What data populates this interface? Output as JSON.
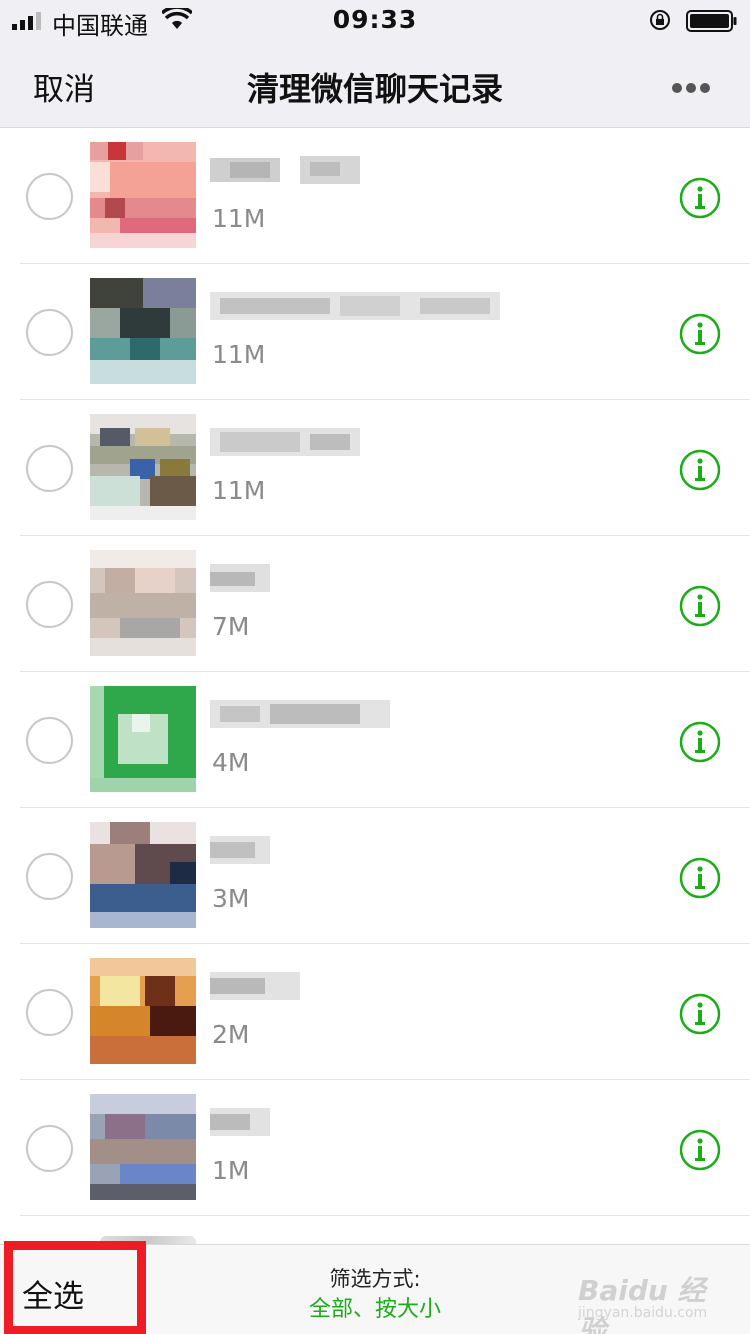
{
  "status_bar": {
    "carrier": "中国联通",
    "time": "09:33"
  },
  "nav": {
    "cancel_label": "取消",
    "title": "清理微信聊天记录",
    "more_icon": "more-icon"
  },
  "chats": [
    {
      "size": "11M"
    },
    {
      "size": "11M"
    },
    {
      "size": "11M"
    },
    {
      "size": "7M"
    },
    {
      "size": "4M"
    },
    {
      "size": "3M"
    },
    {
      "size": "2M"
    },
    {
      "size": "1M"
    }
  ],
  "bottom": {
    "select_all_label": "全选",
    "filter_label": "筛选方式:",
    "filter_value": "全部、按大小"
  },
  "watermark": {
    "main": "Baidu 经验",
    "sub": "jingyan.baidu.com"
  },
  "colors": {
    "accent_green": "#1aad19",
    "highlight_red": "#ee1c25",
    "nav_bg": "#efeff4"
  }
}
